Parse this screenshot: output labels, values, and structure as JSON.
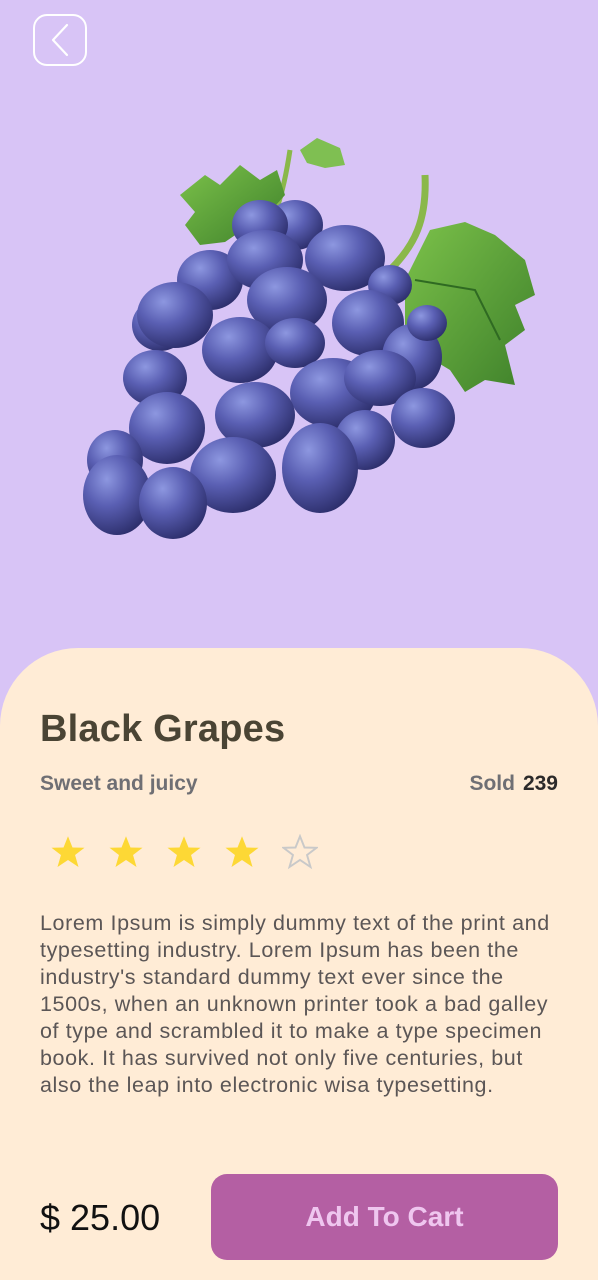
{
  "product": {
    "name": "Black Grapes",
    "subtitle": "Sweet and juicy",
    "sold_label": "Sold",
    "sold_count": "239",
    "rating": 4,
    "rating_max": 5,
    "description": "Lorem Ipsum is simply dummy text of the print and typesetting industry. Lorem Ipsum has been the industry's standard dummy text ever since the 1500s, when an unknown printer took a bad galley of type and scrambled it to make a type specimen book. It has survived not only five centuries, but also the leap into electronic wisa typesetting.",
    "price": "$ 25.00"
  },
  "actions": {
    "add_to_cart_label": "Add To Cart",
    "back_icon": "chevron-left-icon"
  },
  "icons": {
    "star_filled": "star-filled-icon",
    "star_empty": "star-outline-icon",
    "image": "grapes-image"
  },
  "colors": {
    "background": "#d8c4f6",
    "sheet": "#ffecd6",
    "accent_button": "#b45fa3",
    "button_text": "#efc6ef",
    "star": "#fdd835",
    "star_empty": "#c9c9c9",
    "title": "#4a4434"
  }
}
